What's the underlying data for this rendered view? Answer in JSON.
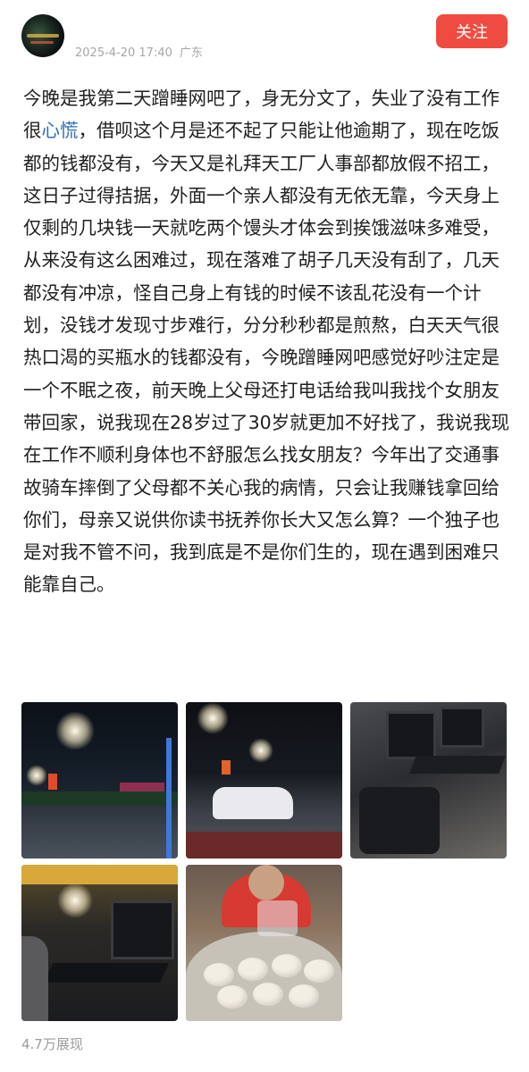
{
  "header": {
    "datetime": "2025-4-20 17:40",
    "location": "广东",
    "follow_label": "关注"
  },
  "post": {
    "text_before": "今晚是我第二天蹭睡网吧了，身无分文了，失业了没有工作很",
    "highlight": "心慌",
    "text_after": "，借呗这个月是还不起了只能让他逾期了，现在吃饭都的钱都没有，今天又是礼拜天工厂人事部都放假不招工，这日子过得拮据，外面一个亲人都没有无依无靠，今天身上仅剩的几块钱一天就吃两个馒头才体会到挨饿滋味多难受，从来没有这么困难过，现在落难了胡子几天没有刮了，几天都没有冲凉，怪自己身上有钱的时候不该乱花没有一个计划，没钱才发现寸步难行，分分秒秒都是煎熬，白天天气很热口渴的买瓶水的钱都没有，今晚蹭睡网吧感觉好吵注定是一个不眠之夜，前天晚上父母还打电话给我叫我找个女朋友带回家，说我现在28岁过了30岁就更加不好找了，我说我现在工作不顺利身体也不舒服怎么找女朋友？今年出了交通事故骑车摔倒了父母都不关心我的病情，只会让我赚钱拿回给你们，母亲又说供你读书抚养你长大又怎么算？一个独子也是对我不管不问，我到底是不是你们生的，现在遇到困难只能靠自己。"
  },
  "footer": {
    "views": "4.7万展现"
  },
  "colors": {
    "follow_bg": "#f04b41",
    "highlight": "#2c6fb5",
    "meta": "#a6a6a6"
  }
}
